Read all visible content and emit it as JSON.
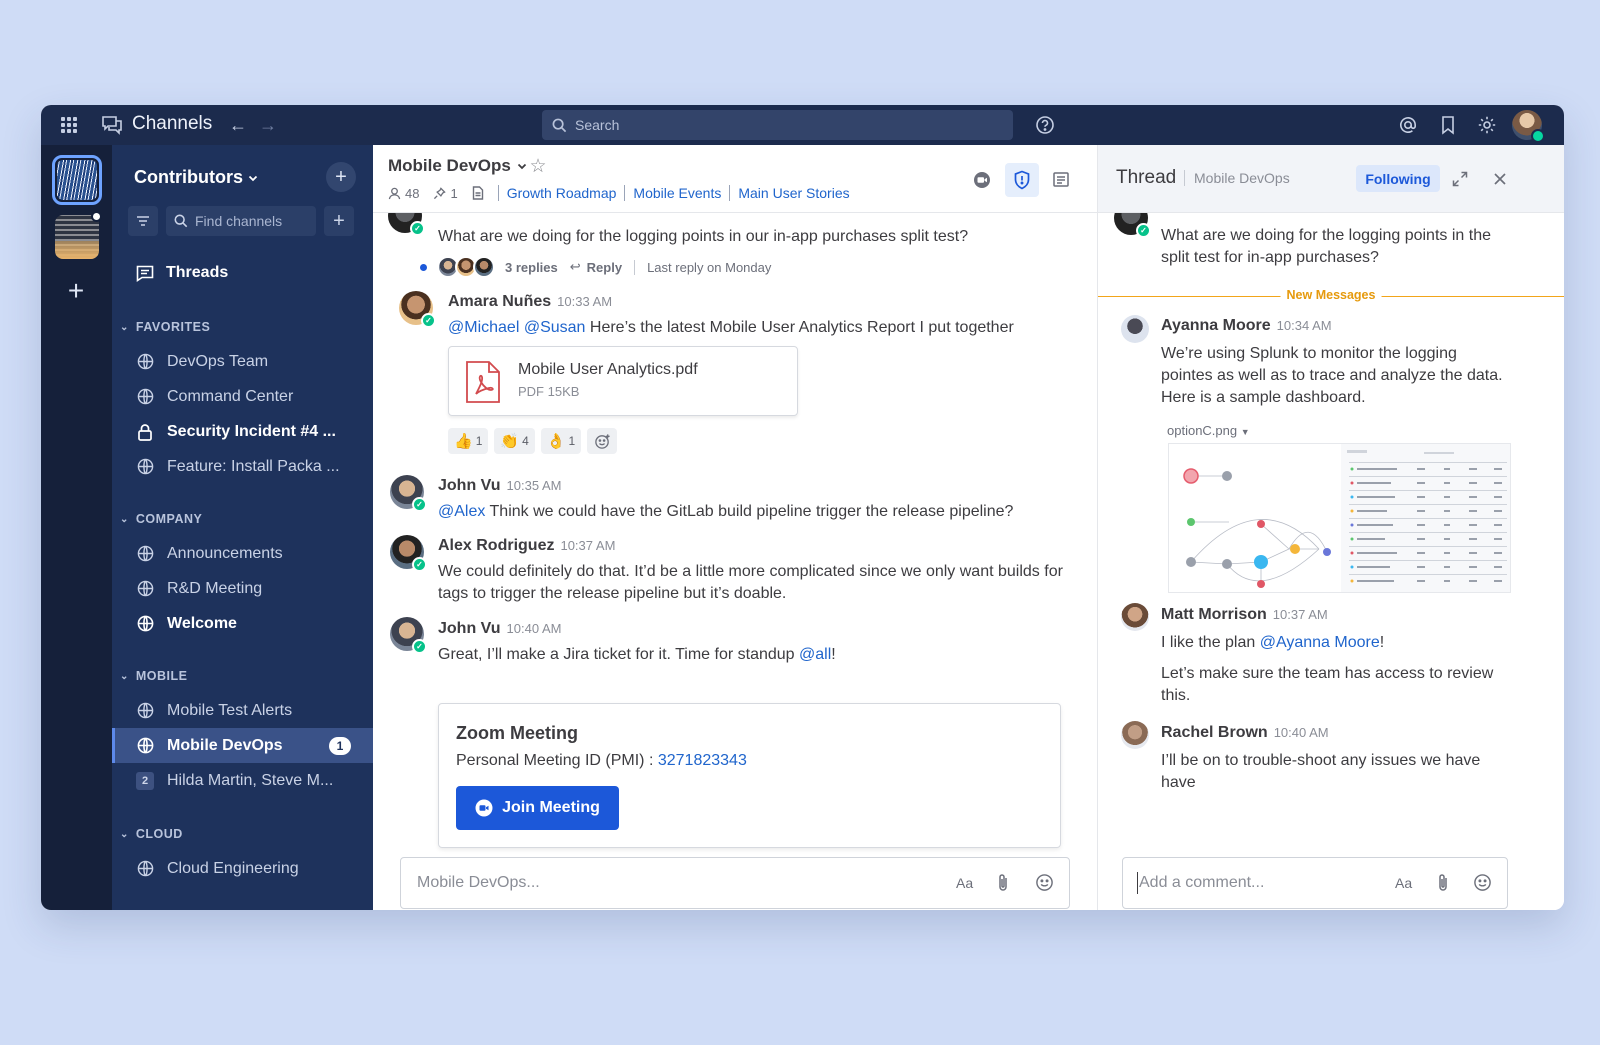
{
  "topbar": {
    "product": "Channels",
    "search_placeholder": "Search"
  },
  "sidebar": {
    "team_name": "Contributors",
    "find_placeholder": "Find channels",
    "threads_label": "Threads",
    "sections": {
      "favorites": "FAVORITES",
      "company": "COMPANY",
      "mobile": "MOBILE",
      "cloud": "CLOUD"
    },
    "favorites": [
      "DevOps Team",
      "Command Center",
      "Security Incident #4 ...",
      "Feature: Install Packa ..."
    ],
    "company": [
      "Announcements",
      "R&D Meeting",
      "Welcome"
    ],
    "mobile": [
      "Mobile Test Alerts",
      "Mobile DevOps",
      "Hilda Martin, Steve M..."
    ],
    "mobile_devops_badge": "1",
    "dm_count": "2",
    "cloud": [
      "Cloud Engineering"
    ]
  },
  "channel": {
    "name": "Mobile DevOps",
    "members": "48",
    "pinned": "1",
    "links": [
      "Growth Roadmap",
      "Mobile Events",
      "Main User Stories"
    ]
  },
  "posts": {
    "first_text": "What are we doing for the logging points in our in-app purchases split test?",
    "replies": "3 replies",
    "reply": "Reply",
    "last_reply": "Last reply on Monday",
    "amara": {
      "name": "Amara Nuñes",
      "time": "10:33 AM",
      "mention1": "@Michael",
      "mention2": "@Susan",
      "text": "Here’s the latest Mobile User Analytics Report I put together",
      "file_name": "Mobile User Analytics.pdf",
      "file_size": "PDF 15KB",
      "reactions": [
        {
          "emoji": "👍",
          "count": "1"
        },
        {
          "emoji": "👏",
          "count": "4"
        },
        {
          "emoji": "👌",
          "count": "1"
        }
      ]
    },
    "john1": {
      "name": "John Vu",
      "time": "10:35 AM",
      "mention": "@Alex",
      "text": "Think we could have the GitLab build pipeline trigger the release pipeline?"
    },
    "alex": {
      "name": "Alex Rodriguez",
      "time": "10:37 AM",
      "text1": "We could definitely do that. It’d be a little more complicated since we only want builds for",
      "text2": "tags to trigger the release pipeline but it’s doable."
    },
    "john2": {
      "name": "John Vu",
      "time": "10:40 AM",
      "text": "Great, I’ll make a Jira ticket for it. Time for standup",
      "mention": "@all",
      "end": "!"
    },
    "zoom": {
      "title": "Zoom Meeting",
      "pmi_label": "Personal Meeting ID (PMI) :",
      "pmi": "3271823343",
      "join": "Join Meeting"
    }
  },
  "composer": {
    "placeholder": "Mobile DevOps...",
    "format": "Aa"
  },
  "thread": {
    "title": "Thread",
    "channel": "Mobile DevOps",
    "following": "Following",
    "root_text1": "What are we doing for the logging points in the",
    "root_text2": "split test for in-app purchases?",
    "new_messages": "New Messages",
    "ayanna": {
      "name": "Ayanna Moore",
      "time": "10:34 AM",
      "text1": "We’re using Splunk to monitor the logging",
      "text2": "pointes as well as to trace and analyze the data.",
      "text3": "Here is a sample dashboard.",
      "image_name": "optionC.png"
    },
    "matt": {
      "name": "Matt Morrison",
      "time": "10:37 AM",
      "text1": "I like the plan",
      "mention": "@Ayanna Moore",
      "end": "!",
      "text2": "Let’s make sure the team has access to review",
      "text3": "this."
    },
    "rachel": {
      "name": "Rachel Brown",
      "time": "10:40 AM",
      "text1": "I’ll be on to trouble-shoot any issues we have",
      "text2": "have"
    },
    "comment_placeholder": "Add a comment...",
    "format": "Aa"
  }
}
